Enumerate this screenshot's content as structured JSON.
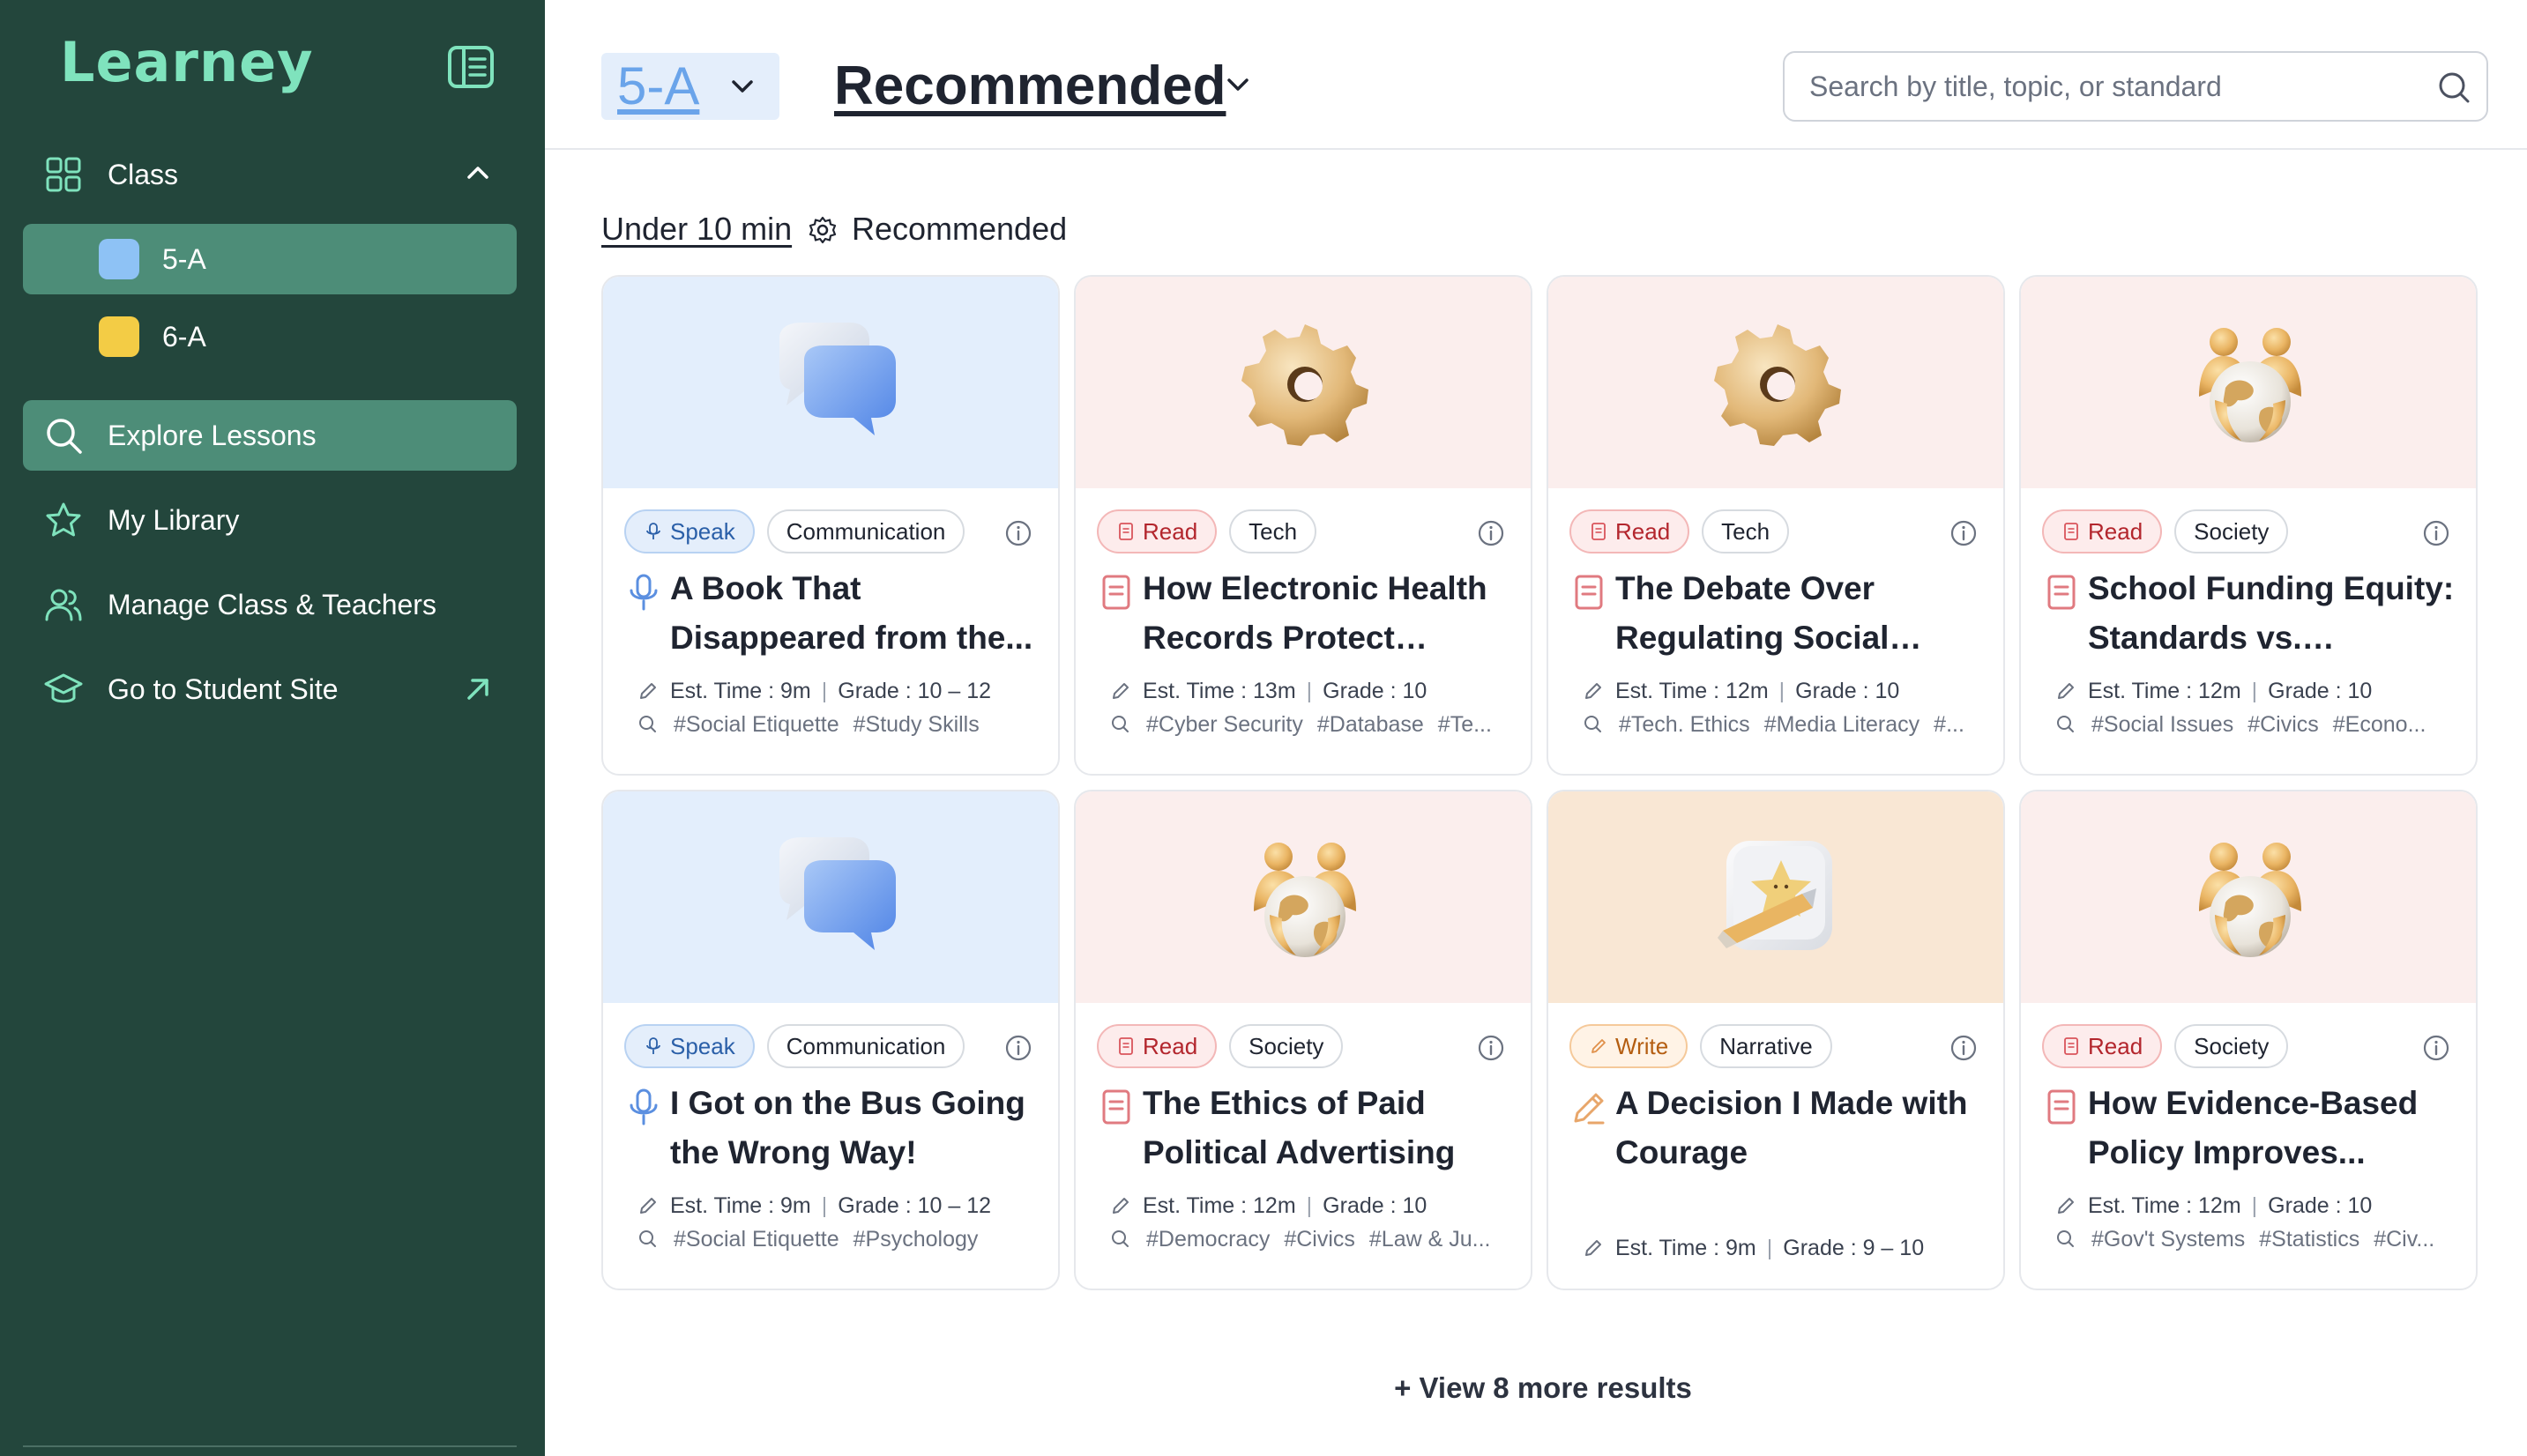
{
  "brand": {
    "name": "Learney"
  },
  "sidebar": {
    "class_section": {
      "label": "Class"
    },
    "classes": [
      {
        "label": "5-A",
        "color": "#8ec2f5"
      },
      {
        "label": "6-A",
        "color": "#f3cc45"
      }
    ],
    "items": [
      {
        "label": "Explore Lessons",
        "icon": "search-icon"
      },
      {
        "label": "My Library",
        "icon": "star-icon"
      },
      {
        "label": "Manage Class & Teachers",
        "icon": "users-icon"
      },
      {
        "label": "Go to Student Site",
        "icon": "graduation-cap-icon"
      }
    ]
  },
  "header": {
    "class_select": {
      "value": "5-A"
    },
    "view_select": {
      "value": "Recommended"
    },
    "search": {
      "placeholder": "Search by title, topic, or standard"
    }
  },
  "filters": {
    "time": "Under 10 min",
    "mode": "Recommended"
  },
  "cards": [
    {
      "type": "Speak",
      "topic": "Communication",
      "title": "A Book That Disappeared from the...",
      "time_label": "Est. Time : 9m",
      "grade_label": "Grade : 10 – 12",
      "tags": [
        "#Social Etiquette",
        "#Study Skills"
      ],
      "thumb_icon": "speech-bubbles-icon"
    },
    {
      "type": "Read",
      "topic": "Tech",
      "title": "How Electronic Health Records Protect Patients",
      "time_label": "Est. Time : 13m",
      "grade_label": "Grade : 10",
      "tags": [
        "#Cyber Security",
        "#Database",
        "#Te..."
      ],
      "thumb_icon": "gear-icon"
    },
    {
      "type": "Read",
      "topic": "Tech",
      "title": "The Debate Over Regulating Social Medi...",
      "time_label": "Est. Time : 12m",
      "grade_label": "Grade : 10",
      "tags": [
        "#Tech. Ethics",
        "#Media Literacy",
        "#..."
      ],
      "thumb_icon": "gear-icon"
    },
    {
      "type": "Read",
      "topic": "Society",
      "title": "School Funding Equity: Standards vs. Resources",
      "time_label": "Est. Time : 12m",
      "grade_label": "Grade : 10",
      "tags": [
        "#Social Issues",
        "#Civics",
        "#Econo..."
      ],
      "thumb_icon": "globe-people-icon"
    },
    {
      "type": "Speak",
      "topic": "Communication",
      "title": "I Got on the Bus Going the Wrong Way!",
      "time_label": "Est. Time : 9m",
      "grade_label": "Grade : 10 – 12",
      "tags": [
        "#Social Etiquette",
        "#Psychology"
      ],
      "thumb_icon": "speech-bubbles-icon"
    },
    {
      "type": "Read",
      "topic": "Society",
      "title": "The Ethics of Paid Political Advertising",
      "time_label": "Est. Time : 12m",
      "grade_label": "Grade : 10",
      "tags": [
        "#Democracy",
        "#Civics",
        "#Law & Ju..."
      ],
      "thumb_icon": "globe-people-icon"
    },
    {
      "type": "Write",
      "topic": "Narrative",
      "title": "A Decision I Made with Courage",
      "time_label": "Est. Time : 9m",
      "grade_label": "Grade : 9 – 10",
      "tags": [],
      "thumb_icon": "pencil-star-icon"
    },
    {
      "type": "Read",
      "topic": "Society",
      "title": "How Evidence-Based Policy Improves...",
      "time_label": "Est. Time : 12m",
      "grade_label": "Grade : 10",
      "tags": [
        "#Gov't Systems",
        "#Statistics",
        "#Civ..."
      ],
      "thumb_icon": "globe-people-icon"
    }
  ],
  "view_more": {
    "label": "+ View 8 more results"
  },
  "colors": {
    "sidebar_bg": "#23463c",
    "sidebar_active": "#4d8d78",
    "brand": "#7fe3bd",
    "speak": "#2a5fa8",
    "read": "#b3262d",
    "write": "#b45d10"
  }
}
